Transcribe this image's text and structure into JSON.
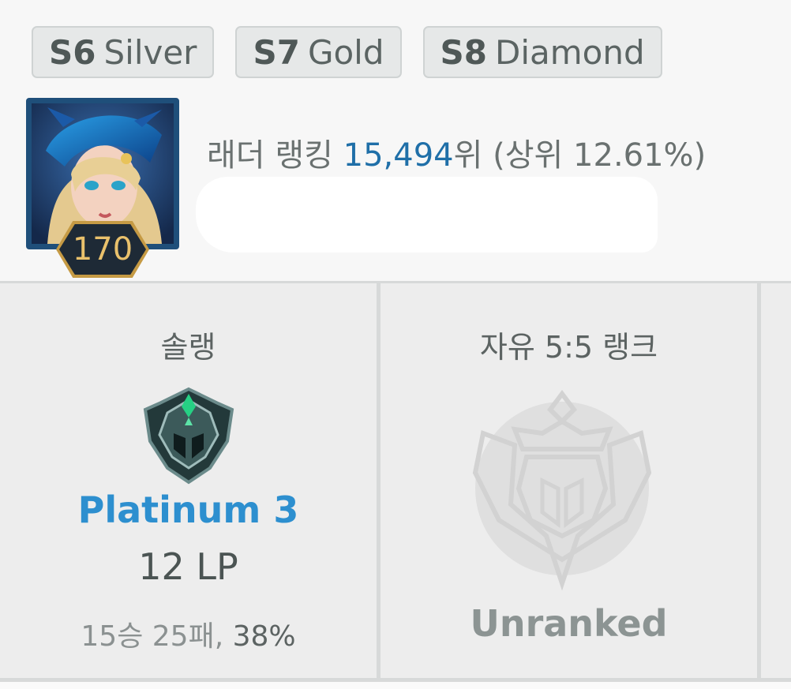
{
  "season_badges": [
    {
      "season": "S6",
      "tier": "Silver"
    },
    {
      "season": "S7",
      "tier": "Gold"
    },
    {
      "season": "S8",
      "tier": "Diamond"
    }
  ],
  "profile": {
    "level": "170",
    "ladder_label": "래더 랭킹",
    "ladder_rank": "15,494",
    "ladder_suffix": "위 (상위 12.61%)"
  },
  "queues": [
    {
      "title": "솔랭",
      "tier": "Platinum 3",
      "lp": "12 LP",
      "record": "15승 25패,",
      "winrate": "38%",
      "emblem_icon": "platinum-emblem-icon"
    },
    {
      "title": "자유 5:5 랭크",
      "tier": "Unranked",
      "emblem_icon": "unranked-emblem-icon"
    }
  ],
  "colors": {
    "tier_blue": "#2d8fcf",
    "rank_blue": "#1f6fa8",
    "level_gold": "#e9c16c"
  }
}
